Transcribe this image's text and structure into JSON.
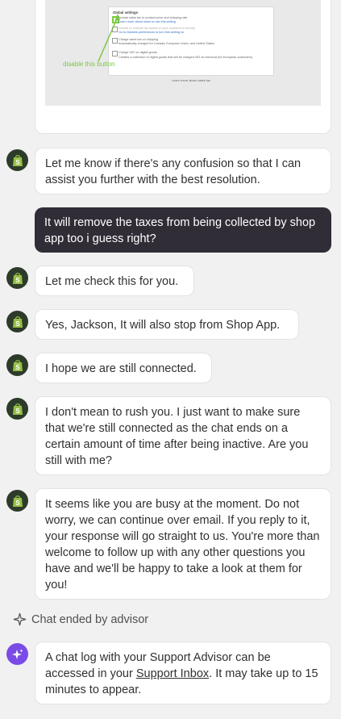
{
  "screenshot_card": {
    "panel_title": "Global settings",
    "rows": [
      "Include sales tax in product price and shipping rate",
      "Learn more about when to use this setting",
      "Include or exclude tax based on your customer's country",
      "Go to Markets preferences to turn this setting on",
      "Charge sales tax on shipping",
      "Automatically charged for Canada, European Union, and United States",
      "Charge VAT on digital goods",
      "Creates a collection of digital goods that will be charged VAT at checkout (for European customers)"
    ],
    "footer": "Learn more about sales tax",
    "annotation": "disable this button"
  },
  "messages": [
    {
      "from": "advisor",
      "text": "Let me know if there's any confusion so that I can assist you further with the best resolution."
    },
    {
      "from": "user",
      "text": "It will remove the taxes from being collected by shop app too i guess right?"
    },
    {
      "from": "advisor",
      "text": "Let me check this for you."
    },
    {
      "from": "advisor",
      "text": "Yes, Jackson, It will also stop from Shop App."
    },
    {
      "from": "advisor",
      "text": "I hope we are still connected."
    },
    {
      "from": "advisor",
      "text": "I don't mean to rush you. I just want to make sure that we're still connected as the chat ends on a certain amount of time after being inactive. Are you still with me?"
    },
    {
      "from": "advisor",
      "text": "It seems like you are busy at the moment. Do not worry, we can continue over email. If you reply to it, your response will go straight to us. You're more than welcome to follow up with any other questions you have and we'll be happy to take a look at them for you!"
    }
  ],
  "status": {
    "ended_text": "Chat ended by advisor"
  },
  "final": {
    "before": "A chat log with your Support Advisor can be accessed in your ",
    "link": "Support Inbox",
    "after": ". It may take up to 15 minutes to appear."
  },
  "colors": {
    "shopify_green": "#95bf47",
    "user_bubble": "#302d36",
    "ai_purple": "#7a4be6"
  }
}
